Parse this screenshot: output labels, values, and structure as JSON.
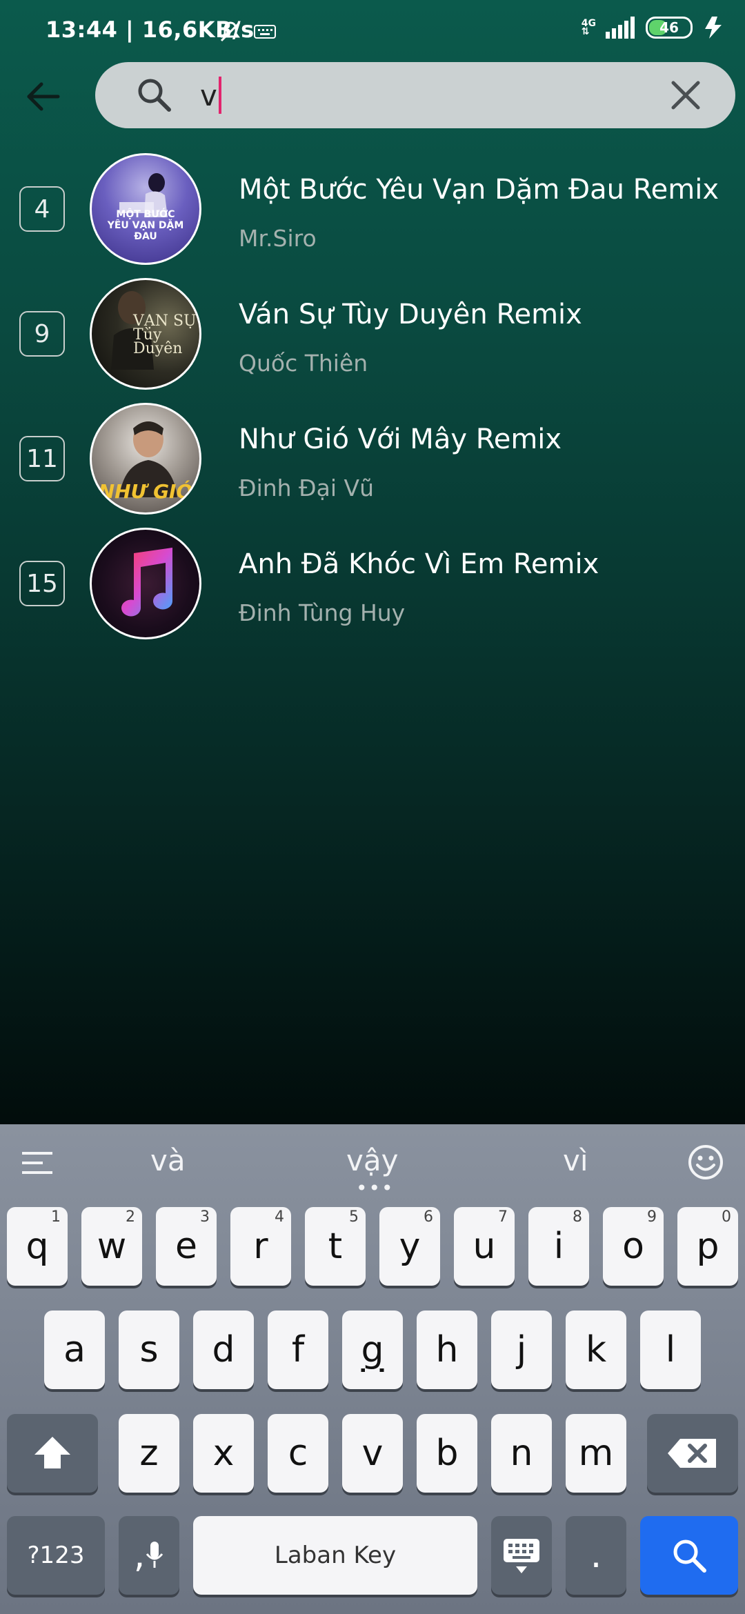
{
  "status_bar": {
    "time": "13:44 | 16,6KB/s",
    "network": "4G",
    "battery": "46"
  },
  "search": {
    "query": "v",
    "back_icon": "back-arrow-icon",
    "search_icon": "search-icon",
    "clear_icon": "close-icon"
  },
  "results": [
    {
      "rank": "4",
      "title": "Một Bước Yêu Vạn Dặm Đau Remix",
      "artist": "Mr.Siro",
      "cover_text": "MỘT BƯỚC YÊU VẠN DẶM ĐAU"
    },
    {
      "rank": "9",
      "title": "Ván Sự Tùy Duyên Remix",
      "artist": "Quốc Thiên",
      "cover_text": "VẠN SỰ Tùy Duyên"
    },
    {
      "rank": "11",
      "title": "Như Gió Với Mây Remix",
      "artist": "Đinh Đại Vũ",
      "cover_text": "NHƯ GIÓ"
    },
    {
      "rank": "15",
      "title": "Anh Đã Khóc Vì Em Remix",
      "artist": "Đinh Tùng Huy",
      "cover_text": ""
    }
  ],
  "keyboard": {
    "suggestions": [
      "và",
      "vậy",
      "vì"
    ],
    "row1": [
      {
        "k": "q",
        "n": "1"
      },
      {
        "k": "w",
        "n": "2"
      },
      {
        "k": "e",
        "n": "3"
      },
      {
        "k": "r",
        "n": "4"
      },
      {
        "k": "t",
        "n": "5"
      },
      {
        "k": "y",
        "n": "6"
      },
      {
        "k": "u",
        "n": "7"
      },
      {
        "k": "i",
        "n": "8"
      },
      {
        "k": "o",
        "n": "9"
      },
      {
        "k": "p",
        "n": "0"
      }
    ],
    "row2": [
      "a",
      "s",
      "d",
      "f",
      "g",
      "h",
      "j",
      "k",
      "l"
    ],
    "row3": [
      "z",
      "x",
      "c",
      "v",
      "b",
      "n",
      "m"
    ],
    "numbers_label": "?123",
    "comma_label": ",",
    "space_label": "Laban Key",
    "period_label": "."
  }
}
